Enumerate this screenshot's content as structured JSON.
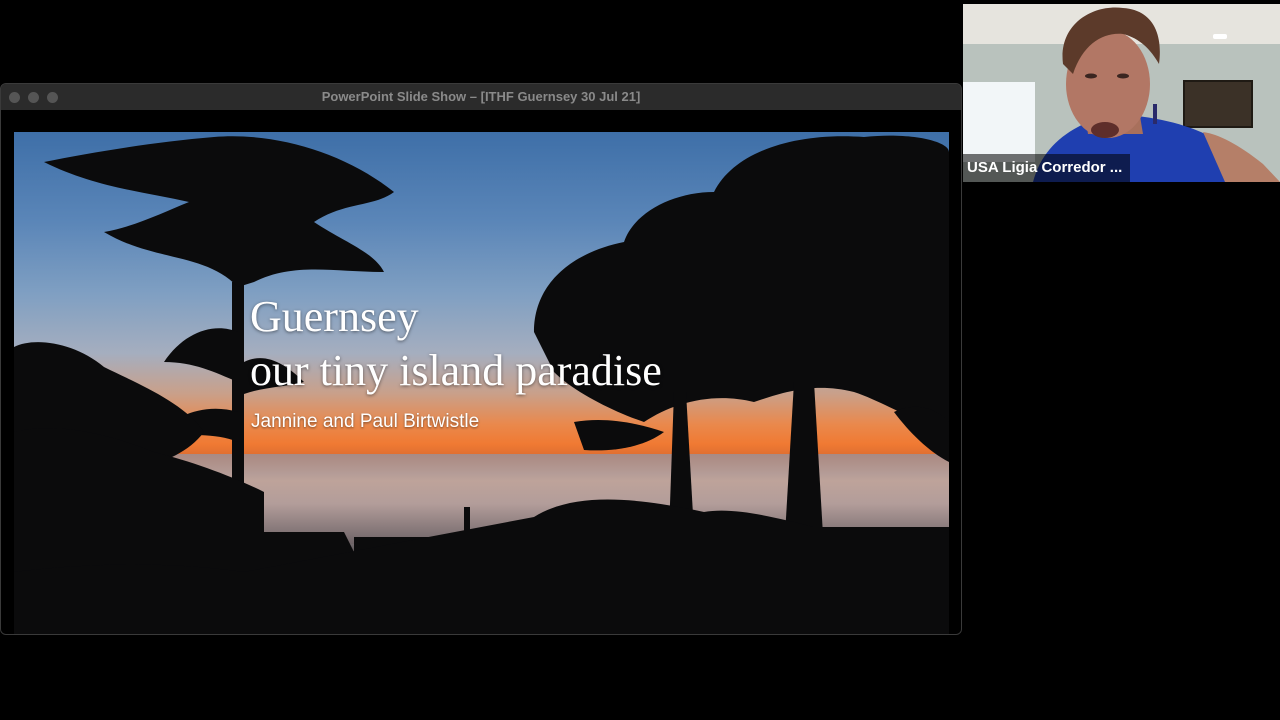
{
  "window": {
    "title": "PowerPoint Slide Show – [ITHF Guernsey 30 Jul 21]"
  },
  "slide": {
    "title_lines": [
      "Guernsey",
      "our tiny island paradise"
    ],
    "subtitle": "Jannine and Paul Birtwistle"
  },
  "participant": {
    "name": "USA Ligia Corredor ..."
  },
  "icons": {
    "close": "close-dot",
    "minimize": "minimize-dot",
    "zoom": "zoom-dot"
  }
}
